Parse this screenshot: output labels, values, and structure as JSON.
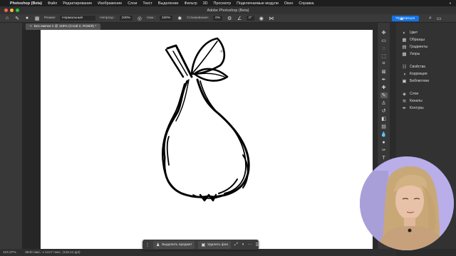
{
  "menubar": {
    "app": "Photoshop (Beta)",
    "items": [
      "Файл",
      "Редактирование",
      "Изображение",
      "Слои",
      "Текст",
      "Выделение",
      "Фильтр",
      "3D",
      "Просмотр",
      "Подключаемые модули",
      "Окно",
      "Справка"
    ]
  },
  "window": {
    "title": "Adobe Photoshop (Beta)"
  },
  "options": {
    "mode_label": "Режим:",
    "mode_value": "Нормальный",
    "opacity_label": "Непрозр.:",
    "opacity_value": "100%",
    "pressure_label": "Наж.:",
    "pressure_value": "100%",
    "smoothing_label": "Сглаживание:",
    "smoothing_value": "0%",
    "angle_value": "0°",
    "share_label": "Поделиться"
  },
  "document": {
    "tab_label": "Без имени-1 @ 119% (Слой 2, RGB/8) *"
  },
  "panels": {
    "group1": [
      {
        "icon": "color-wheel-icon",
        "label": "Цвет"
      },
      {
        "icon": "swatches-icon",
        "label": "Образцы"
      },
      {
        "icon": "gradient-icon",
        "label": "Градиенты"
      },
      {
        "icon": "pattern-icon",
        "label": "Узоры"
      }
    ],
    "group2": [
      {
        "icon": "properties-icon",
        "label": "Свойства"
      },
      {
        "icon": "adjustments-icon",
        "label": "Коррекция"
      },
      {
        "icon": "libraries-icon",
        "label": "Библиотеки"
      }
    ],
    "group3": [
      {
        "icon": "layers-icon",
        "label": "Слои"
      },
      {
        "icon": "channels-icon",
        "label": "Каналы"
      },
      {
        "icon": "paths-icon",
        "label": "Контуры"
      }
    ]
  },
  "status": {
    "zoom": "119,37%",
    "doc_info": "3840 пикс. x 1417 пикс. (118,11 ppi)"
  },
  "taskbar": {
    "select_subject": "Выделить предмет",
    "remove_bg": "Удалить фон",
    "more": "···"
  },
  "colors": {
    "accent": "#1473e6",
    "chrome_dark": "#2b2b2b",
    "panel": "#323232",
    "canvas": "#ffffff"
  }
}
